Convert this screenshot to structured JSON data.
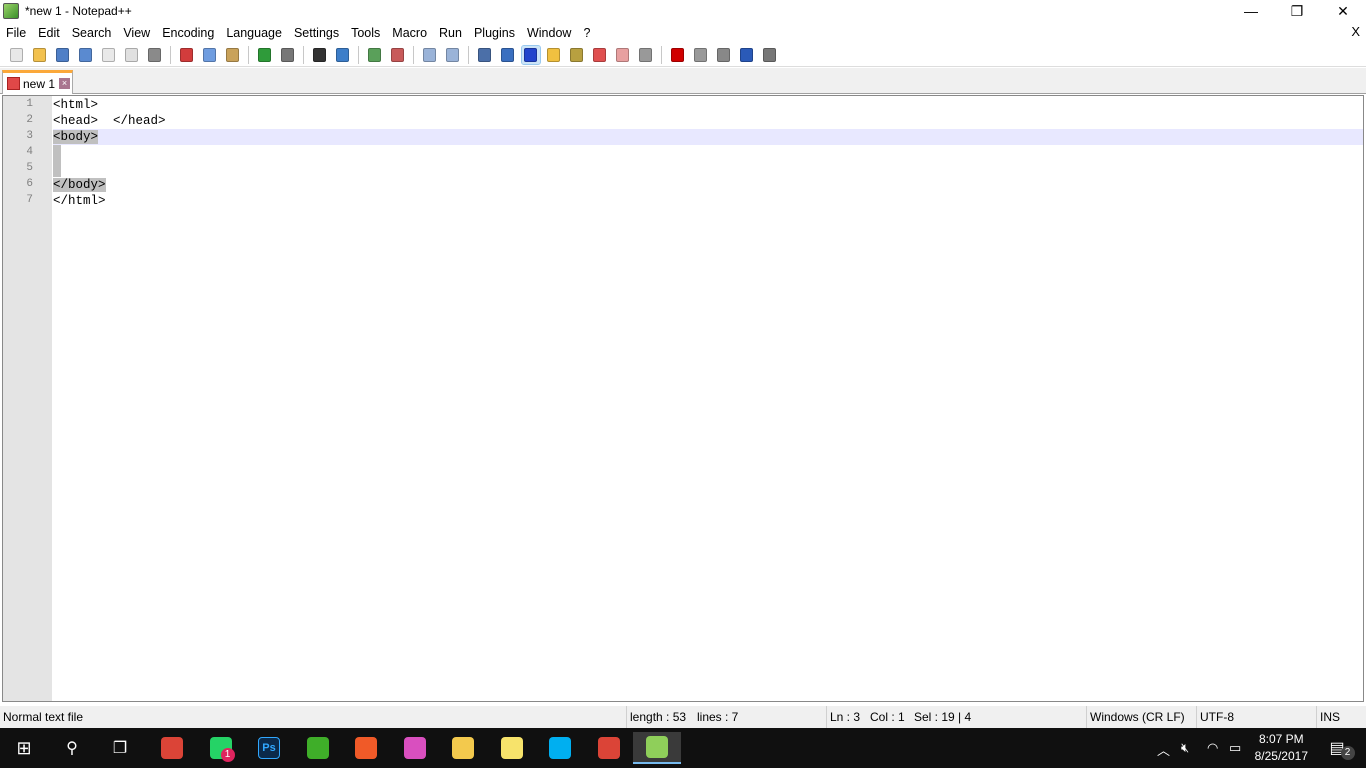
{
  "window": {
    "title": "*new 1 - Notepad++",
    "minimize": "—",
    "restore": "❐",
    "close": "✕"
  },
  "menu": [
    "File",
    "Edit",
    "Search",
    "View",
    "Encoding",
    "Language",
    "Settings",
    "Tools",
    "Macro",
    "Run",
    "Plugins",
    "Window",
    "?"
  ],
  "menu_close": "X",
  "toolbar": [
    [
      {
        "name": "new-file-icon",
        "color": "#e8e8e8"
      },
      {
        "name": "open-file-icon",
        "color": "#f2c14e"
      },
      {
        "name": "save-icon",
        "color": "#4f7fc7"
      },
      {
        "name": "save-all-icon",
        "color": "#5a8ad0"
      },
      {
        "name": "close-icon",
        "color": "#e9e9e9"
      },
      {
        "name": "close-all-icon",
        "color": "#e0e0e0"
      },
      {
        "name": "print-icon",
        "color": "#8a8a8a"
      }
    ],
    [
      {
        "name": "cut-icon",
        "color": "#d23c3c"
      },
      {
        "name": "copy-icon",
        "color": "#6f9de0"
      },
      {
        "name": "paste-icon",
        "color": "#c9a25a"
      }
    ],
    [
      {
        "name": "undo-icon",
        "color": "#2f9b3a"
      },
      {
        "name": "redo-icon",
        "color": "#777777"
      }
    ],
    [
      {
        "name": "find-icon",
        "color": "#333333"
      },
      {
        "name": "replace-icon",
        "color": "#3d7ec9"
      }
    ],
    [
      {
        "name": "zoom-in-icon",
        "color": "#5aa05a"
      },
      {
        "name": "zoom-out-icon",
        "color": "#c85a5a"
      }
    ],
    [
      {
        "name": "sync-vertical-icon",
        "color": "#9ab3d8"
      },
      {
        "name": "sync-horizontal-icon",
        "color": "#9ab3d8"
      }
    ],
    [
      {
        "name": "word-wrap-icon",
        "color": "#4b6fa8"
      },
      {
        "name": "show-all-characters-icon",
        "color": "#3a6fc0"
      },
      {
        "name": "indent-guide-icon",
        "color": "#2244cc",
        "active": true
      },
      {
        "name": "udl-icon",
        "color": "#f0c040"
      },
      {
        "name": "document-map-icon",
        "color": "#b8a040"
      },
      {
        "name": "function-list-icon",
        "color": "#e05050"
      },
      {
        "name": "folder-as-workspace-icon",
        "color": "#e8a0a0"
      },
      {
        "name": "monitoring-icon",
        "color": "#999999"
      }
    ],
    [
      {
        "name": "record-macro-icon",
        "color": "#d00000"
      },
      {
        "name": "stop-recording-icon",
        "color": "#999999"
      },
      {
        "name": "playback-icon",
        "color": "#888888"
      },
      {
        "name": "run-macro-multiple-icon",
        "color": "#2a5ab8"
      },
      {
        "name": "save-macro-icon",
        "color": "#777777"
      }
    ]
  ],
  "tab": {
    "label": "new 1",
    "close": "×"
  },
  "editor": {
    "line_numbers": [
      "1",
      "2",
      "3",
      "4",
      "5",
      "6",
      "7"
    ],
    "lines": [
      "<html>",
      "<head>  </head>",
      "<body>",
      "",
      "",
      "</body>",
      "</html>"
    ],
    "current_line": 3
  },
  "status": {
    "file_type": "Normal text file",
    "length": "length : 53",
    "lines": "lines : 7",
    "ln": "Ln : 3",
    "col": "Col : 1",
    "sel": "Sel : 19 | 4",
    "eol": "Windows (CR LF)",
    "encoding": "UTF-8",
    "mode": "INS"
  },
  "taskbar": {
    "apps": [
      {
        "name": "chrome-app",
        "color": "#db4437"
      },
      {
        "name": "whatsapp-app",
        "color": "#25d366",
        "badge": "1"
      },
      {
        "name": "photoshop-app",
        "color": "#0b2a4a",
        "label": "Ps"
      },
      {
        "name": "camtasia-app",
        "color": "#3fae29"
      },
      {
        "name": "camtasia-recorder-app",
        "color": "#f05a28"
      },
      {
        "name": "paint-3d-app",
        "color": "#d94fbf"
      },
      {
        "name": "file-explorer-app",
        "color": "#f3c94d"
      },
      {
        "name": "sticky-notes-app",
        "color": "#f7e36b"
      },
      {
        "name": "skype-app",
        "color": "#00aff0"
      },
      {
        "name": "chrome-profile-app",
        "color": "#db4437"
      },
      {
        "name": "notepad-plus-plus-app",
        "color": "#8fcf5a",
        "active": true
      }
    ],
    "time": "8:07 PM",
    "date": "8/25/2017",
    "notifications": "2"
  }
}
